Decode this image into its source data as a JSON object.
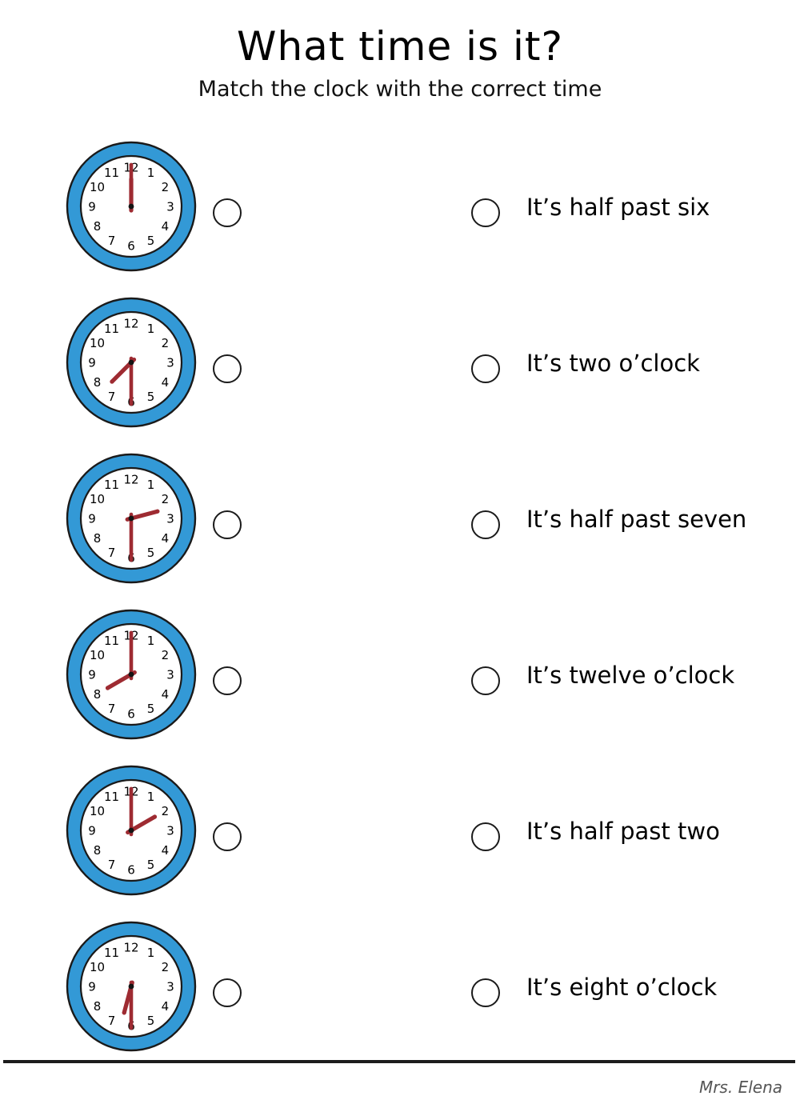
{
  "header": {
    "title": "What time is it?",
    "subtitle": "Match the clock with the correct time"
  },
  "colors": {
    "rim_blue": "#3399D6",
    "rim_blue_dark": "#2079B4",
    "rim_outline": "#1a1a1a",
    "face_white": "#ffffff",
    "hand_red": "#9E2B32",
    "hub_black": "#141414",
    "text_black": "#000000",
    "footer_gray": "#555555"
  },
  "clock_style": {
    "numerals": [
      "12",
      "1",
      "2",
      "3",
      "4",
      "5",
      "6",
      "7",
      "8",
      "9",
      "10",
      "11"
    ],
    "numeral_font_size": 15,
    "numeral_radius": 49
  },
  "rows": [
    {
      "index": 1,
      "clock": {
        "name": "clock-twelve-oclock",
        "time_label": "twelve o'clock",
        "hour": 12,
        "minute": 0,
        "hour_hand_angle": 0,
        "minute_hand_angle": 0
      },
      "left_bubble": "answer-bubble-1",
      "right_bubble": "option-bubble-1",
      "option_text": "It’s half past six"
    },
    {
      "index": 2,
      "clock": {
        "name": "clock-half-past-seven",
        "time_label": "half past seven",
        "hour": 7,
        "minute": 30,
        "hour_hand_angle": 225,
        "minute_hand_angle": 180
      },
      "left_bubble": "answer-bubble-2",
      "right_bubble": "option-bubble-2",
      "option_text": "It’s two o’clock"
    },
    {
      "index": 3,
      "clock": {
        "name": "clock-half-past-two",
        "time_label": "half past two",
        "hour": 2,
        "minute": 30,
        "hour_hand_angle": 75,
        "minute_hand_angle": 180
      },
      "left_bubble": "answer-bubble-3",
      "right_bubble": "option-bubble-3",
      "option_text": "It’s half past seven"
    },
    {
      "index": 4,
      "clock": {
        "name": "clock-eight-oclock",
        "time_label": "eight o'clock",
        "hour": 8,
        "minute": 0,
        "hour_hand_angle": 240,
        "minute_hand_angle": 0
      },
      "left_bubble": "answer-bubble-4",
      "right_bubble": "option-bubble-4",
      "option_text": "It’s twelve o’clock"
    },
    {
      "index": 5,
      "clock": {
        "name": "clock-two-oclock",
        "time_label": "two o'clock",
        "hour": 2,
        "minute": 0,
        "hour_hand_angle": 60,
        "minute_hand_angle": 0
      },
      "left_bubble": "answer-bubble-5",
      "right_bubble": "option-bubble-5",
      "option_text": "It’s half past two"
    },
    {
      "index": 6,
      "clock": {
        "name": "clock-half-past-six",
        "time_label": "half past six",
        "hour": 6,
        "minute": 30,
        "hour_hand_angle": 195,
        "minute_hand_angle": 180
      },
      "left_bubble": "answer-bubble-6",
      "right_bubble": "option-bubble-6",
      "option_text": "It’s eight o’clock"
    }
  ],
  "footer": {
    "credit": "Mrs. Elena"
  }
}
